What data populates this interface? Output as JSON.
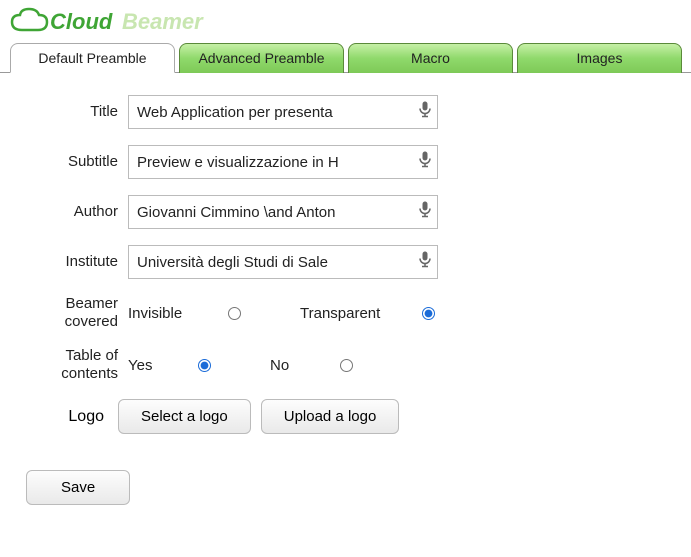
{
  "brand": {
    "cloud": "Cloud",
    "beamer": "Beamer"
  },
  "tabs": {
    "default": "Default Preamble",
    "advanced": "Advanced Preamble",
    "macro": "Macro",
    "images": "Images"
  },
  "labels": {
    "title": "Title",
    "subtitle": "Subtitle",
    "author": "Author",
    "institute": "Institute",
    "covered": "Beamer covered",
    "toc": "Table of contents",
    "logo": "Logo"
  },
  "fields": {
    "title": "Web Application per presenta",
    "subtitle": "Preview e visualizzazione in H",
    "author": "Giovanni Cimmino \\and Anton",
    "institute": "Università degli Studi di Sale"
  },
  "covered": {
    "invisible": "Invisible",
    "transparent": "Transparent",
    "selected": "transparent"
  },
  "toc": {
    "yes": "Yes",
    "no": "No",
    "selected": "yes"
  },
  "buttons": {
    "select_logo": "Select a logo",
    "upload_logo": "Upload a logo",
    "save": "Save"
  }
}
